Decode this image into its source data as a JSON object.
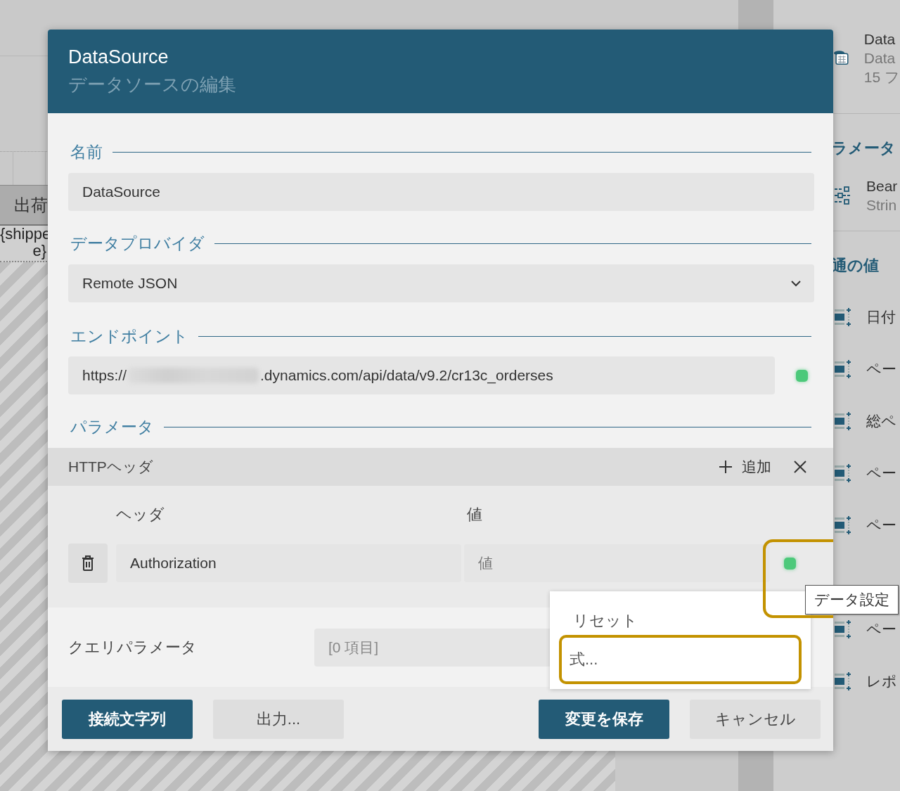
{
  "background": {
    "table_header": "出荷",
    "table_cell_lines": [
      "{shippe",
      "e}"
    ]
  },
  "side_panel": {
    "data_source": {
      "name": "Data",
      "subtitle": "Data",
      "fields": "15 フ"
    },
    "parameters_heading": "ラメータ",
    "parameter": {
      "name": "Bear",
      "type": "Strin"
    },
    "common_values_heading": "通の値",
    "common_values": [
      "日付",
      "ペー",
      "総ペ",
      "ペー",
      "ペー",
      "ペー",
      "レポ"
    ]
  },
  "dialog": {
    "title": "DataSource",
    "subtitle": "データソースの編集",
    "name_label": "名前",
    "name_value": "DataSource",
    "provider_label": "データプロバイダ",
    "provider_value": "Remote JSON",
    "endpoint_label": "エンドポイント",
    "endpoint": {
      "prefix": "https://",
      "redacted": true,
      "suffix": ".dynamics.com/api/data/v9.2/cr13c_orderses",
      "connected": true
    },
    "parameters_label": "パラメータ",
    "http_headers": {
      "title": "HTTPヘッダ",
      "add": "追加",
      "columns": [
        "ヘッダ",
        "値"
      ],
      "rows": [
        {
          "header": "Authorization",
          "value_placeholder": "値",
          "connected": true,
          "status_highlighted": true
        }
      ]
    },
    "query_params": {
      "label": "クエリパラメータ",
      "value": "[0 項目]"
    },
    "left_buttons": [
      {
        "label": "接続文字列",
        "primary": true
      },
      {
        "label": "出力...",
        "primary": false
      }
    ],
    "right_buttons": [
      {
        "label": "変更を保存",
        "primary": true
      },
      {
        "label": "キャンセル",
        "primary": false
      }
    ]
  },
  "context_menu": {
    "items": [
      {
        "label": "リセット",
        "highlighted": false
      },
      {
        "label": "式...",
        "highlighted": true
      }
    ]
  },
  "tooltip": "データ設定"
}
